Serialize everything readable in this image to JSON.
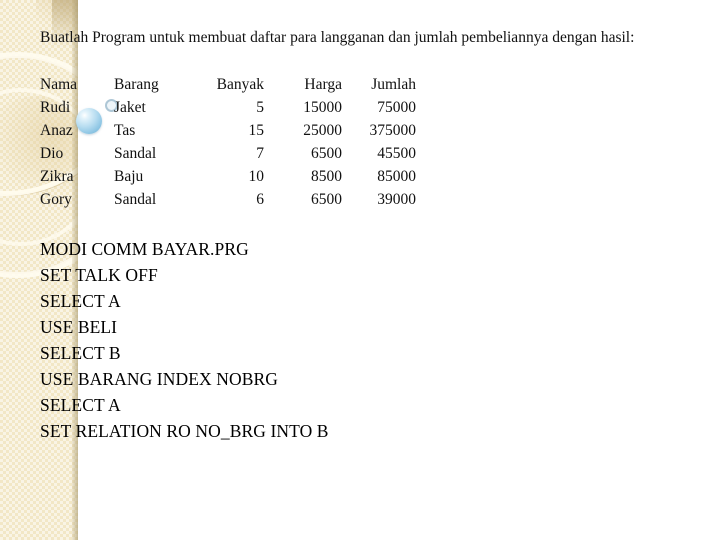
{
  "slide": {
    "intro_paragraph": "Buatlah Program untuk membuat daftar para langganan dan jumlah pembeliannya dengan hasil:",
    "table": {
      "headers": [
        "Nama",
        "Barang",
        "Banyak",
        "Harga",
        "Jumlah"
      ],
      "rows": [
        [
          "Rudi",
          "Jaket",
          "5",
          "15000",
          "75000"
        ],
        [
          "Anaz",
          "Tas",
          "15",
          "25000",
          "375000"
        ],
        [
          "Dio",
          "Sandal",
          "7",
          "6500",
          "45500"
        ],
        [
          "Zikra",
          "Baju",
          "10",
          "8500",
          "85000"
        ],
        [
          "Gory",
          "Sandal",
          "6",
          "6500",
          "39000"
        ]
      ]
    },
    "code_lines": [
      "MODI COMM BAYAR.PRG",
      "SET TALK OFF",
      "SELECT A",
      "USE BELI",
      "SELECT B",
      "USE BARANG INDEX NOBRG",
      "SELECT A",
      "SET RELATION RO NO_BRG INTO B"
    ],
    "decoration": {
      "panel_color": "#f2e7c6",
      "sphere_color": "#b6dcf0",
      "arc_highlight_color": "#fffcee",
      "text_color": "#111111"
    }
  }
}
